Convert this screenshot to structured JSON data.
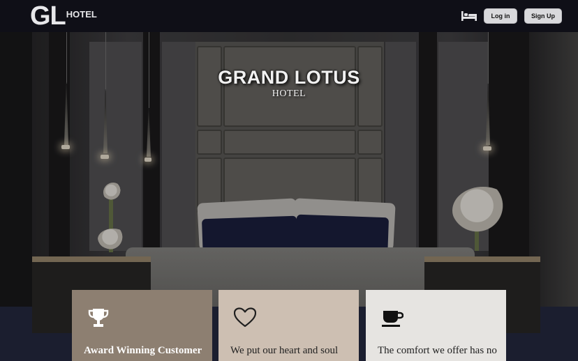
{
  "nav": {
    "logo_mark": "GL",
    "logo_word": "HOTEL",
    "rooms_icon": "bed-icon",
    "login_label": "Log in",
    "signup_label": "Sign Up"
  },
  "hero": {
    "title": "GRAND LOTUS",
    "subtitle": "HOTEL"
  },
  "features": [
    {
      "icon": "trophy-icon",
      "text": "Award Winning Customer"
    },
    {
      "icon": "heart-icon",
      "text": "We put our heart and soul"
    },
    {
      "icon": "coffee-cup-icon",
      "text": "The comfort we offer has no"
    }
  ],
  "colors": {
    "navbar": "#0f0f17",
    "button": "#d9d9dc",
    "card_1": "#8d7f71",
    "card_2": "#cdbfb2",
    "card_3": "#e6e4e1"
  }
}
